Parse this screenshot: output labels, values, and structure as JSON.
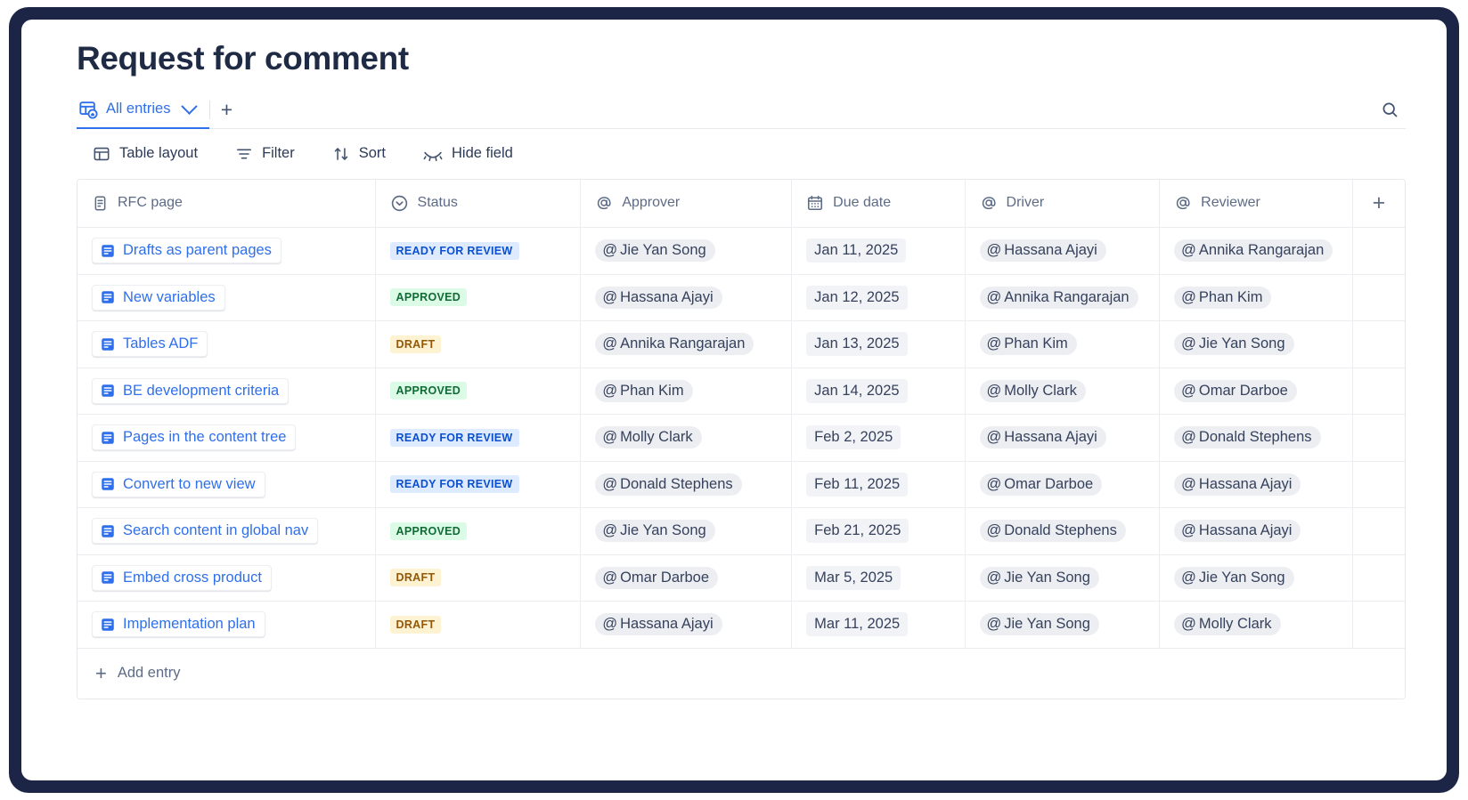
{
  "page": {
    "title": "Request for comment"
  },
  "viewbar": {
    "tab": {
      "label": "All entries",
      "icon": "table-view-icon",
      "chevron": "chevron-down-icon"
    },
    "add_view_label": "+",
    "search_icon": "search-icon"
  },
  "toolbar": {
    "items": [
      {
        "label": "Table layout",
        "icon": "table-layout-icon"
      },
      {
        "label": "Filter",
        "icon": "filter-icon"
      },
      {
        "label": "Sort",
        "icon": "sort-icon"
      },
      {
        "label": "Hide field",
        "icon": "hide-field-icon"
      }
    ]
  },
  "table": {
    "columns": [
      {
        "label": "RFC page",
        "icon": "page-icon"
      },
      {
        "label": "Status",
        "icon": "status-chevron-icon"
      },
      {
        "label": "Approver",
        "icon": "mention-at-icon"
      },
      {
        "label": "Due date",
        "icon": "calendar-icon"
      },
      {
        "label": "Driver",
        "icon": "mention-at-icon"
      },
      {
        "label": "Reviewer",
        "icon": "mention-at-icon"
      }
    ],
    "add_column_label": "+",
    "rows": [
      {
        "page": "Drafts as parent pages",
        "status": {
          "label": "READY FOR REVIEW",
          "tone": "blue"
        },
        "approver": "Jie Yan Song",
        "due_date": "Jan 11, 2025",
        "driver": "Hassana Ajayi",
        "reviewer": "Annika Rangarajan"
      },
      {
        "page": "New variables",
        "status": {
          "label": "APPROVED",
          "tone": "green"
        },
        "approver": "Hassana Ajayi",
        "due_date": "Jan 12, 2025",
        "driver": "Annika Rangarajan",
        "reviewer": "Phan Kim"
      },
      {
        "page": "Tables ADF",
        "status": {
          "label": "DRAFT",
          "tone": "yellow"
        },
        "approver": "Annika Rangarajan",
        "due_date": "Jan 13, 2025",
        "driver": "Phan Kim",
        "reviewer": "Jie Yan Song"
      },
      {
        "page": "BE development criteria",
        "status": {
          "label": "APPROVED",
          "tone": "green"
        },
        "approver": "Phan Kim",
        "due_date": "Jan 14, 2025",
        "driver": "Molly Clark",
        "reviewer": "Omar Darboe"
      },
      {
        "page": "Pages in the content tree",
        "status": {
          "label": "READY FOR REVIEW",
          "tone": "blue"
        },
        "approver": "Molly Clark",
        "due_date": "Feb 2, 2025",
        "driver": "Hassana Ajayi",
        "reviewer": "Donald Stephens"
      },
      {
        "page": "Convert to new view",
        "status": {
          "label": "READY FOR REVIEW",
          "tone": "blue"
        },
        "approver": "Donald Stephens",
        "due_date": "Feb 11, 2025",
        "driver": "Omar Darboe",
        "reviewer": "Hassana Ajayi"
      },
      {
        "page": "Search content in global nav",
        "status": {
          "label": "APPROVED",
          "tone": "green"
        },
        "approver": "Jie Yan Song",
        "due_date": "Feb 21, 2025",
        "driver": "Donald Stephens",
        "reviewer": "Hassana Ajayi"
      },
      {
        "page": "Embed cross product",
        "status": {
          "label": "DRAFT",
          "tone": "yellow"
        },
        "approver": "Omar Darboe",
        "due_date": "Mar 5, 2025",
        "driver": "Jie Yan Song",
        "reviewer": "Jie Yan Song"
      },
      {
        "page": "Implementation plan",
        "status": {
          "label": "DRAFT",
          "tone": "yellow"
        },
        "approver": "Hassana Ajayi",
        "due_date": "Mar 11, 2025",
        "driver": "Jie Yan Song",
        "reviewer": "Molly Clark"
      }
    ],
    "add_entry_label": "Add entry",
    "add_entry_icon": "plus-icon"
  },
  "colors": {
    "accent": "#2f6feb",
    "frame": "#1d2547",
    "text": "#1f2a44",
    "muted": "#5d6b85",
    "status_blue_bg": "#deebff",
    "status_blue_fg": "#0b50cf",
    "status_green_bg": "#dcfbe7",
    "status_green_fg": "#106b35",
    "status_yellow_bg": "#fdf3d2",
    "status_yellow_fg": "#935708"
  }
}
